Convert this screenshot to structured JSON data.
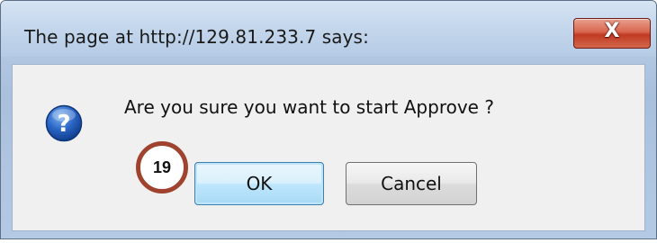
{
  "dialog": {
    "title": "The page at http://129.81.233.7 says:",
    "close_symbol": "X",
    "message": "Are you sure you want to start Approve ?",
    "icon": "question-icon",
    "buttons": {
      "ok_label": "OK",
      "cancel_label": "Cancel"
    }
  },
  "annotation": {
    "step_number": "19",
    "badge_color": "#a0432e"
  },
  "colors": {
    "ok_focus": "#3c7fb1",
    "close_button": "#c03a22",
    "question_icon": "#2a66c6"
  }
}
